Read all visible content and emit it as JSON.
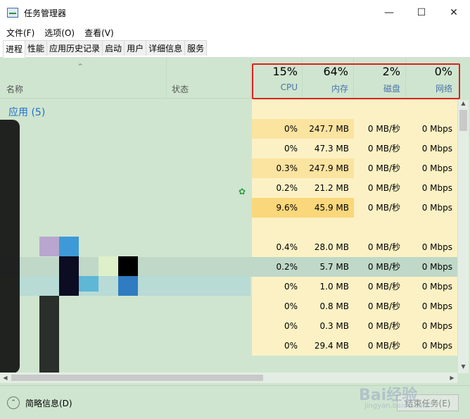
{
  "window": {
    "title": "任务管理器",
    "controls": [
      "minimize-icon",
      "maximize-icon",
      "close-icon"
    ]
  },
  "menu": [
    "文件(F)",
    "选项(O)",
    "查看(V)"
  ],
  "tabs": [
    {
      "label": "进程",
      "active": true
    },
    {
      "label": "性能"
    },
    {
      "label": "应用历史记录"
    },
    {
      "label": "启动"
    },
    {
      "label": "用户"
    },
    {
      "label": "详细信息"
    },
    {
      "label": "服务"
    }
  ],
  "columns": {
    "name": "名称",
    "status": "状态",
    "cpu": {
      "pct": "15%",
      "label": "CPU"
    },
    "memory": {
      "pct": "64%",
      "label": "内存"
    },
    "disk": {
      "pct": "2%",
      "label": "磁盘"
    },
    "network": {
      "pct": "0%",
      "label": "网络"
    }
  },
  "group": {
    "label": "应用 (5)"
  },
  "rows": [
    {
      "cpu": "",
      "mem": "",
      "disk": "",
      "net": "",
      "heat": 0
    },
    {
      "cpu": "0%",
      "mem": "247.7 MB",
      "disk": "0 MB/秒",
      "net": "0 Mbps",
      "heat": 2
    },
    {
      "cpu": "0%",
      "mem": "47.3 MB",
      "disk": "0 MB/秒",
      "net": "0 Mbps",
      "heat": 1
    },
    {
      "cpu": "0.3%",
      "mem": "247.9 MB",
      "disk": "0 MB/秒",
      "net": "0 Mbps",
      "heat": 2
    },
    {
      "cpu": "0.2%",
      "mem": "21.2 MB",
      "disk": "0 MB/秒",
      "net": "0 Mbps",
      "heat": 1
    },
    {
      "cpu": "9.6%",
      "mem": "45.9 MB",
      "disk": "0 MB/秒",
      "net": "0 Mbps",
      "heat": 3
    },
    {
      "cpu": "",
      "mem": "",
      "disk": "",
      "net": "",
      "heat": 0
    },
    {
      "cpu": "0.4%",
      "mem": "28.0 MB",
      "disk": "0 MB/秒",
      "net": "0 Mbps",
      "heat": 1
    },
    {
      "cpu": "0.2%",
      "mem": "5.7 MB",
      "disk": "0 MB/秒",
      "net": "0 Mbps",
      "heat": 0,
      "selected": true
    },
    {
      "cpu": "0%",
      "mem": "1.0 MB",
      "disk": "0 MB/秒",
      "net": "0 Mbps",
      "heat": 1
    },
    {
      "cpu": "0%",
      "mem": "0.8 MB",
      "disk": "0 MB/秒",
      "net": "0 Mbps",
      "heat": 1
    },
    {
      "cpu": "0%",
      "mem": "0.3 MB",
      "disk": "0 MB/秒",
      "net": "0 Mbps",
      "heat": 1
    },
    {
      "cpu": "0%",
      "mem": "29.4 MB",
      "disk": "0 MB/秒",
      "net": "0 Mbps",
      "heat": 1
    }
  ],
  "footer": {
    "fewer_details": "简略信息(D)",
    "end_task": "结束任务(E)"
  },
  "watermark": {
    "main": "Bai经验",
    "sub": "jingyan.baidu.com"
  },
  "colors": {
    "background": "#cfe5cf",
    "heat_1": "#fbf1c4",
    "heat_2": "#fbe3a0",
    "heat_3": "#f9d77a",
    "accent_blue": "#1e6fc8",
    "highlight_red": "#e02020"
  }
}
